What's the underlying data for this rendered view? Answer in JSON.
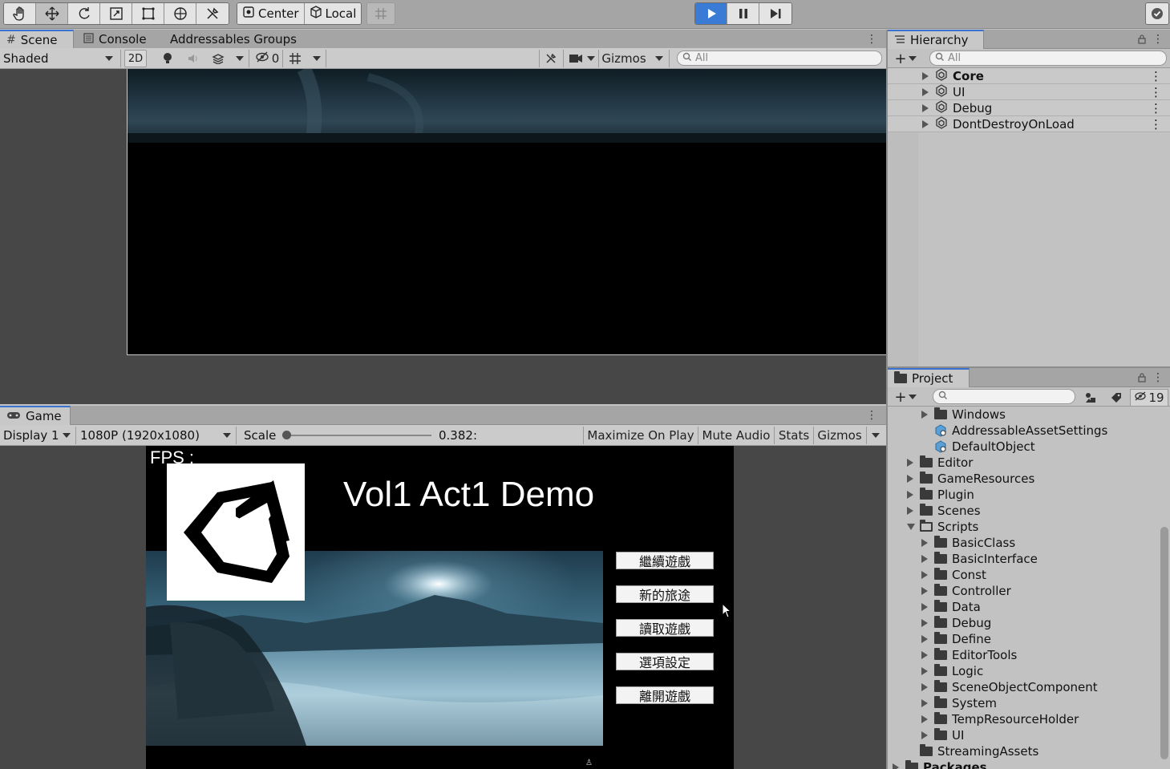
{
  "toolbar": {
    "pivot_center": "Center",
    "pivot_local": "Local"
  },
  "scene_tabs": {
    "scene": "Scene",
    "console": "Console",
    "addressables": "Addressables Groups"
  },
  "scene_bar": {
    "shading": "Shaded",
    "mode_2d": "2D",
    "hidden_count": "0",
    "gizmos": "Gizmos",
    "search_placeholder": "All"
  },
  "game_tab": {
    "label": "Game"
  },
  "game_bar": {
    "display": "Display 1",
    "resolution": "1080P (1920x1080)",
    "scale_label": "Scale",
    "scale_value": "0.382:",
    "scale_fraction": 0.382,
    "maximize": "Maximize On Play",
    "mute": "Mute Audio",
    "stats": "Stats",
    "gizmos": "Gizmos"
  },
  "game": {
    "fps": "FPS :",
    "title": "Vol1 Act1 Demo",
    "menu": [
      "繼續遊戲",
      "新的旅途",
      "讀取遊戲",
      "選項設定",
      "離開遊戲"
    ]
  },
  "hierarchy": {
    "title": "Hierarchy",
    "search_placeholder": "All",
    "items": [
      "Core",
      "UI",
      "Debug",
      "DontDestroyOnLoad"
    ]
  },
  "project": {
    "title": "Project",
    "hidden_count": "19",
    "items": [
      {
        "name": "Windows",
        "type": "folder",
        "indent": 2,
        "arrow": "right"
      },
      {
        "name": "AddressableAssetSettings",
        "type": "asset",
        "indent": 2,
        "arrow": "none"
      },
      {
        "name": "DefaultObject",
        "type": "asset",
        "indent": 2,
        "arrow": "none"
      },
      {
        "name": "Editor",
        "type": "folder",
        "indent": 1,
        "arrow": "right"
      },
      {
        "name": "GameResources",
        "type": "folder",
        "indent": 1,
        "arrow": "right"
      },
      {
        "name": "Plugin",
        "type": "folder",
        "indent": 1,
        "arrow": "right"
      },
      {
        "name": "Scenes",
        "type": "folder",
        "indent": 1,
        "arrow": "right"
      },
      {
        "name": "Scripts",
        "type": "folder-open",
        "indent": 1,
        "arrow": "down"
      },
      {
        "name": "BasicClass",
        "type": "folder",
        "indent": 2,
        "arrow": "right"
      },
      {
        "name": "BasicInterface",
        "type": "folder",
        "indent": 2,
        "arrow": "right"
      },
      {
        "name": "Const",
        "type": "folder",
        "indent": 2,
        "arrow": "right"
      },
      {
        "name": "Controller",
        "type": "folder",
        "indent": 2,
        "arrow": "right"
      },
      {
        "name": "Data",
        "type": "folder",
        "indent": 2,
        "arrow": "right"
      },
      {
        "name": "Debug",
        "type": "folder",
        "indent": 2,
        "arrow": "right"
      },
      {
        "name": "Define",
        "type": "folder",
        "indent": 2,
        "arrow": "right"
      },
      {
        "name": "EditorTools",
        "type": "folder",
        "indent": 2,
        "arrow": "right"
      },
      {
        "name": "Logic",
        "type": "folder",
        "indent": 2,
        "arrow": "right"
      },
      {
        "name": "SceneObjectComponent",
        "type": "folder",
        "indent": 2,
        "arrow": "right"
      },
      {
        "name": "System",
        "type": "folder",
        "indent": 2,
        "arrow": "right"
      },
      {
        "name": "TempResourceHolder",
        "type": "folder",
        "indent": 2,
        "arrow": "right"
      },
      {
        "name": "UI",
        "type": "folder",
        "indent": 2,
        "arrow": "right"
      },
      {
        "name": "StreamingAssets",
        "type": "folder",
        "indent": 1,
        "arrow": "none"
      },
      {
        "name": "Packages",
        "type": "folder",
        "indent": 0,
        "arrow": "right"
      }
    ]
  },
  "colors": {
    "accent": "#3a7bd5",
    "editor_bg": "#c2c2c2",
    "viewport_bg": "#474747"
  }
}
